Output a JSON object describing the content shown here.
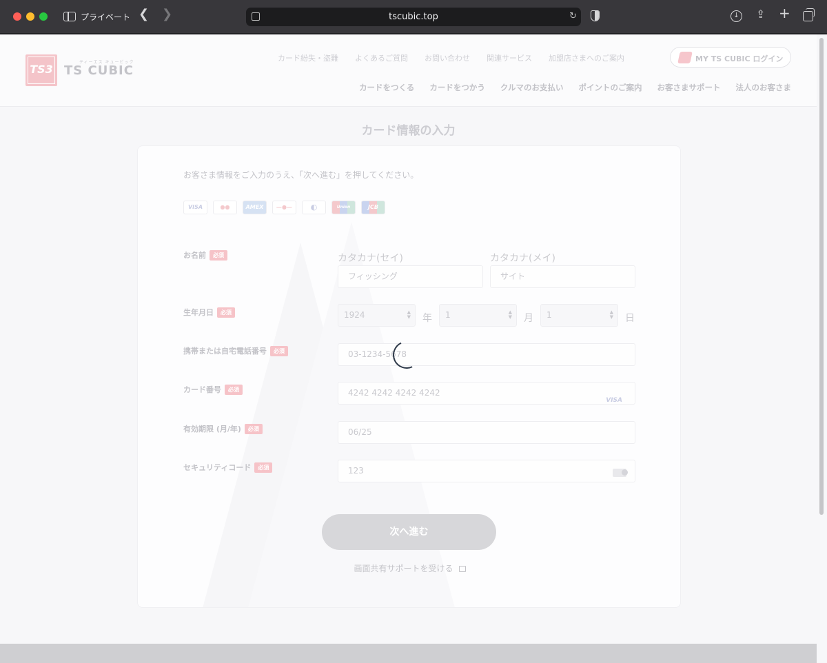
{
  "browser": {
    "mode_label": "プライベート",
    "url": "tscubic.top"
  },
  "header": {
    "logo_text": "TS3",
    "logo_tagline": "ティーエス キュービック",
    "brand_name": "TS CUBIC",
    "util_links": [
      "カード紛失・盗難",
      "よくあるご質問",
      "お問い合わせ",
      "関連サービス",
      "加盟店さまへのご案内"
    ],
    "login_label": "MY TS CUBIC  ログイン",
    "main_links": [
      "カードをつくる",
      "カードをつかう",
      "クルマのお支払い",
      "ポイントのご案内",
      "お客さまサポート",
      "法人のお客さま"
    ]
  },
  "page": {
    "title": "カード情報の入力",
    "intro": "お客さま情報をご入力のうえ、「次へ進む」を押してください。",
    "brands": [
      "VISA",
      "●●",
      "AMEX",
      "—●—",
      "◐",
      "Union",
      "JCB"
    ]
  },
  "form": {
    "required_badge": "必須",
    "name": {
      "label": "お名前",
      "sei_label": "カタカナ(セイ)",
      "sei_value": "フィッシング",
      "mei_label": "カタカナ(メイ)",
      "mei_value": "サイト"
    },
    "birthdate": {
      "label": "生年月日",
      "year": "1924",
      "year_unit": "年",
      "month": "1",
      "month_unit": "月",
      "day": "1",
      "day_unit": "日"
    },
    "phone": {
      "label": "携帯または自宅電話番号",
      "value": "03-1234-5678"
    },
    "card_number": {
      "label": "カード番号",
      "value": "4242 4242 4242 4242",
      "brand": "VISA"
    },
    "expiry": {
      "label": "有効期限 (月/年)",
      "value": "06/25"
    },
    "cvc": {
      "label": "セキュリティコード",
      "value": "123"
    },
    "submit_label": "次へ進む",
    "support_link": "画面共有サポートを受ける"
  },
  "icons": {
    "sidebar": "sidebar-icon",
    "back": "chevron-left-icon",
    "forward": "chevron-right-icon",
    "reload": "reload-icon",
    "privacy": "shield-icon",
    "download": "download-icon",
    "share": "share-icon",
    "new_tab": "plus-icon",
    "tabs": "tabs-icon",
    "loading": "spinner-icon"
  }
}
